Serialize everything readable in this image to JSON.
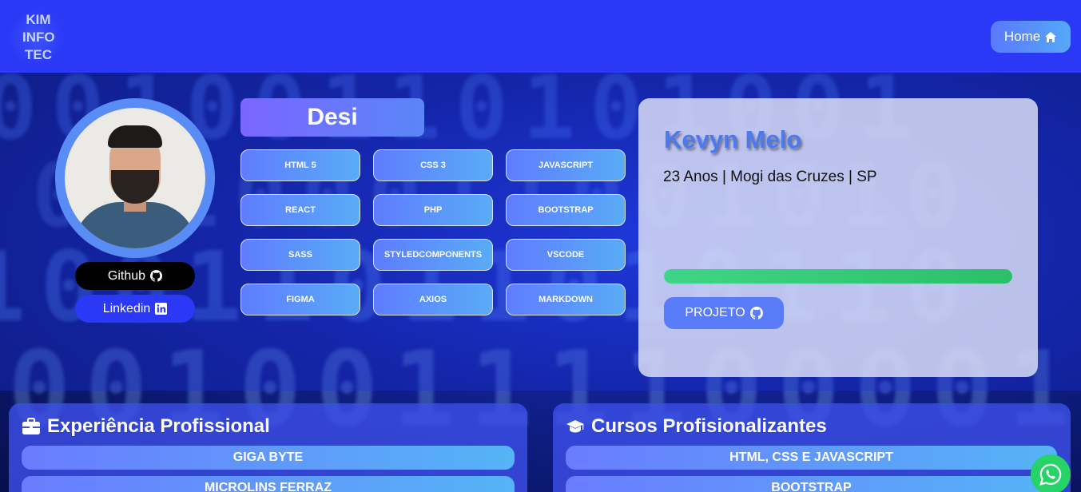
{
  "navbar": {
    "logo_lines": [
      "KIM",
      "INFO",
      "TEC"
    ],
    "home_label": "Home"
  },
  "profile": {
    "github_label": "Github",
    "linkedin_label": "Linkedin"
  },
  "skills": {
    "title": "Desi",
    "items": [
      "HTML 5",
      "CSS 3",
      "JAVASCRIPT",
      "REACT",
      "PHP",
      "BOOTSTRAP",
      "SASS",
      "STYLEDCOMPONENTS",
      "VSCODE",
      "FIGMA",
      "AXIOS",
      "MARKDOWN"
    ]
  },
  "info": {
    "name": "Kevyn Melo",
    "subtitle": "23 Anos | Mogi das Cruzes | SP",
    "progress": 1.0,
    "project_label": "PROJETO"
  },
  "experience": {
    "title": "Experiência Profissional",
    "items": [
      "GIGA BYTE",
      "MICROLINS FERRAZ"
    ]
  },
  "courses": {
    "title": "Cursos Profisionalizantes",
    "items": [
      "HTML, CSS E JAVASCRIPT",
      "BOOTSTRAP"
    ]
  },
  "colors": {
    "navbar": "#2b38f6",
    "accent": "#5b7cf8",
    "progress": "#3fd588",
    "whatsapp": "#25d366"
  },
  "icons": {
    "home": "home-icon",
    "github": "github-icon",
    "linkedin": "linkedin-icon",
    "briefcase": "briefcase-icon",
    "graduation": "graduation-cap-icon",
    "whatsapp": "whatsapp-icon"
  }
}
